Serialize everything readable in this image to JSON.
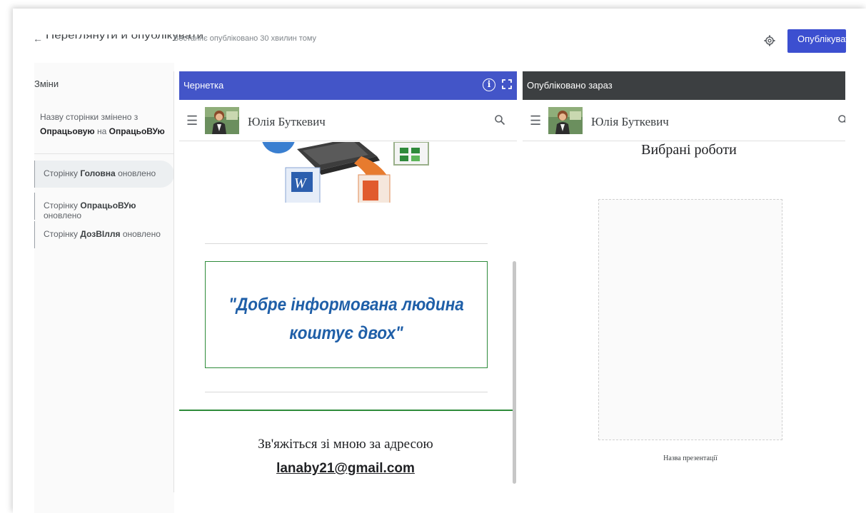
{
  "topbar": {
    "title": "Переглянути й опублікувати",
    "status": "Востаннє опубліковано 30 хвилин тому",
    "publish_label": "Опублікувати"
  },
  "changes": {
    "title": "Зміни",
    "main_prefix": "Назву сторінки змінено з ",
    "main_from": "Опрацьовую",
    "main_mid": " на ",
    "main_to": "ОпрацьоВУю",
    "items": [
      {
        "prefix": "Сторінку ",
        "name": "Головна",
        "suffix": " оновлено"
      },
      {
        "prefix": "Сторінку ",
        "name": "ОпрацьоВУю",
        "suffix": " оновлено"
      },
      {
        "prefix": "Сторінку ",
        "name": "ДозВІлля",
        "suffix": " оновлено"
      }
    ]
  },
  "draft": {
    "header": "Чернетка",
    "site_name": "Юлія Буткевич",
    "quote_line1": "\"Добре інформована людина",
    "quote_line2": "коштує двох\"",
    "contact_text": "Зв'яжіться зі мною за адресою",
    "contact_email": "lanaby21@gmail.com"
  },
  "published": {
    "header": "Опубліковано зараз",
    "site_name": "Юлія Буткевич",
    "heading": "Вибрані роботи",
    "caption": "Назва презентації"
  },
  "icons": {
    "back": "arrow-left-icon",
    "gear": "gear-icon",
    "info": "info-icon",
    "expand": "fullscreen-icon",
    "menu": "hamburger-menu-icon",
    "search": "search-icon"
  },
  "colors": {
    "publish_button": "#3c4fd0",
    "draft_header": "#4355c8",
    "published_header": "#3c3f41",
    "quote_text": "#1f5fa8",
    "quote_border": "#2e8b3a"
  }
}
